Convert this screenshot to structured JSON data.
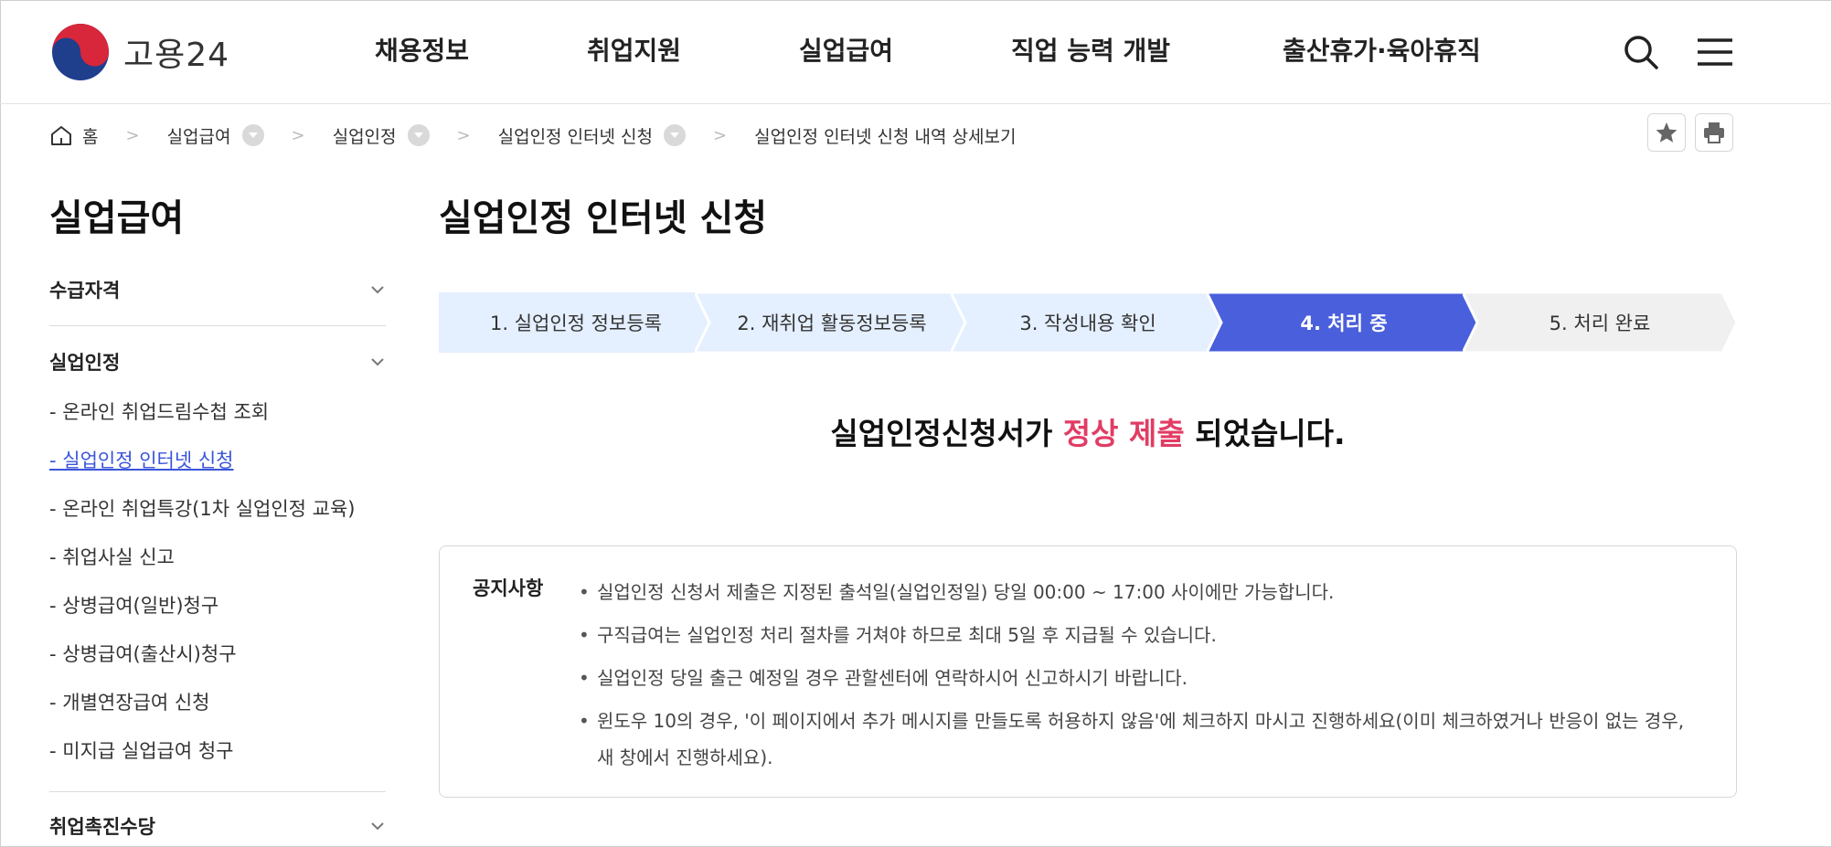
{
  "header": {
    "logo_text": "고용24",
    "nav": [
      "채용정보",
      "취업지원",
      "실업급여",
      "직업 능력 개발",
      "출산휴가·육아휴직"
    ],
    "icons": [
      "search-icon",
      "menu-icon"
    ]
  },
  "breadcrumb": {
    "home": "홈",
    "items": [
      "실업급여",
      "실업인정",
      "실업인정 인터넷 신청",
      "실업인정 인터넷 신청 내역 상세보기"
    ],
    "tools": [
      "star-icon",
      "print-icon"
    ]
  },
  "sidebar": {
    "title": "실업급여",
    "group1": "수급자격",
    "group2": "실업인정",
    "links": [
      "- 온라인 취업드림수첩 조회",
      "- 실업인정 인터넷 신청",
      "- 온라인 취업특강(1차 실업인정 교육)",
      "- 취업사실 신고",
      "- 상병급여(일반)청구",
      "- 상병급여(출산시)청구",
      "- 개별연장급여 신청",
      "- 미지급 실업급여 청구"
    ],
    "group3": "취업촉진수당"
  },
  "main": {
    "title": "실업인정 인터넷 신청",
    "steps": [
      "1. 실업인정 정보등록",
      "2. 재취업 활동정보등록",
      "3. 작성내용 확인",
      "4. 처리 중",
      "5. 처리 완료"
    ],
    "current_step": 4,
    "result": {
      "before": "실업인정신청서가 ",
      "highlight": "정상 제출",
      "after": " 되었습니다."
    },
    "notice": {
      "label": "공지사항",
      "items": [
        "실업인정 신청서 제출은 지정된 출석일(실업인정일) 당일 00:00 ~ 17:00 사이에만 가능합니다.",
        "구직급여는 실업인정 처리 절차를 거쳐야 하므로 최대 5일 후 지급될 수 있습니다.",
        "실업인정 당일 출근 예정일 경우 관할센터에 연락하시어 신고하시기 바랍니다.",
        "윈도우 10의 경우, '이 페이지에서 추가 메시지를 만들도록 허용하지 않음'에 체크하지 마시고 진행하세요(이미 체크하였거나 반응이 없는 경우, 새 창에서 진행하세요)."
      ]
    }
  },
  "colors": {
    "accent": "#4a5fdc",
    "highlight": "#e23c64",
    "step_bg": "#e4efff",
    "step_done_bg": "#f0f0f0"
  }
}
